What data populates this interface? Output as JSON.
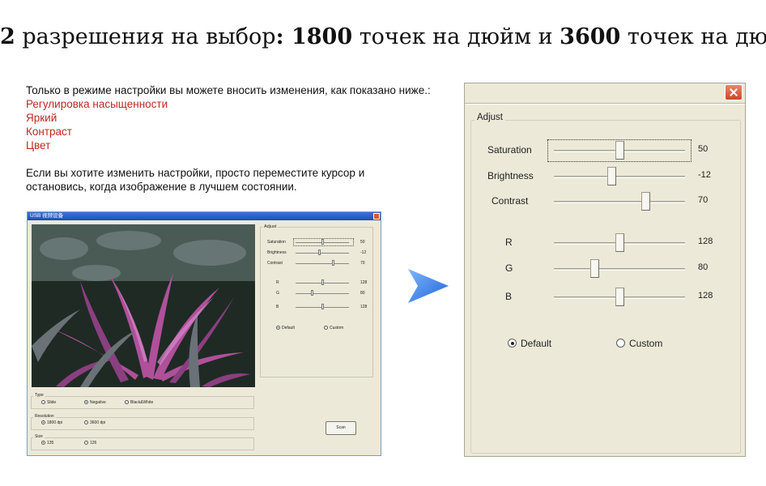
{
  "headline": {
    "p1": "2",
    "p2": " разрешения на выбор",
    "p3": ": 1800",
    "p4": " точек на дюйм и ",
    "p5": "3600",
    "p6": " точек на дюйм"
  },
  "info": {
    "intro": "Только в режиме настройки вы можете вносить изменения, как показано ниже.:",
    "items": [
      "Регулировка насыщенности",
      "Яркий",
      "Контраст",
      "Цвет"
    ],
    "instruction_line1": "Если вы хотите изменить настройки, просто переместите курсор и",
    "instruction_line2": "остановись, когда изображение в лучшем состоянии."
  },
  "colors": {
    "accent_red": "#c0281e",
    "arrow_blue": "#2f7fe6",
    "window_bg": "#ece9d8",
    "close_red": "#c8472c"
  },
  "icons": {
    "arrow": "arrow-right-icon",
    "close": "close-icon"
  },
  "adjust_dialog": {
    "group_label": "Adjust",
    "sliders": [
      {
        "label": "Saturation",
        "value": "50",
        "level": 0.5
      },
      {
        "label": "Brightness",
        "value": "-12",
        "level": 0.44
      },
      {
        "label": "Contrast",
        "value": "70",
        "level": 0.7
      }
    ],
    "rgb": [
      {
        "label": "R",
        "value": "128",
        "level": 0.5
      },
      {
        "label": "G",
        "value": "80",
        "level": 0.31
      },
      {
        "label": "B",
        "value": "128",
        "level": 0.5
      }
    ],
    "radio_default": "Default",
    "radio_custom": "Custom",
    "selected": "Default"
  },
  "app_window": {
    "title": "USB 视频设备",
    "adjust_label": "Adjust",
    "sliders": [
      {
        "label": "Saturation",
        "value": "50",
        "level": 0.5
      },
      {
        "label": "Brightness",
        "value": "-12",
        "level": 0.44
      },
      {
        "label": "Contrast",
        "value": "70",
        "level": 0.7
      },
      {
        "label": "R",
        "value": "128",
        "level": 0.5
      },
      {
        "label": "G",
        "value": "80",
        "level": 0.31
      },
      {
        "label": "B",
        "value": "128",
        "level": 0.5
      }
    ],
    "mode_default": "Default",
    "mode_custom": "Custom",
    "type_label": "Type",
    "type_options": [
      "Slide",
      "Negative",
      "Black&White"
    ],
    "type_selected": "Negative",
    "resolution_label": "Resolution",
    "resolution_options": [
      "1800 dpi",
      "3600 dpi"
    ],
    "resolution_selected": "1800 dpi",
    "size_label": "Size",
    "size_options": [
      "135",
      "126"
    ],
    "size_selected": "135",
    "scan_label": "Scan"
  }
}
